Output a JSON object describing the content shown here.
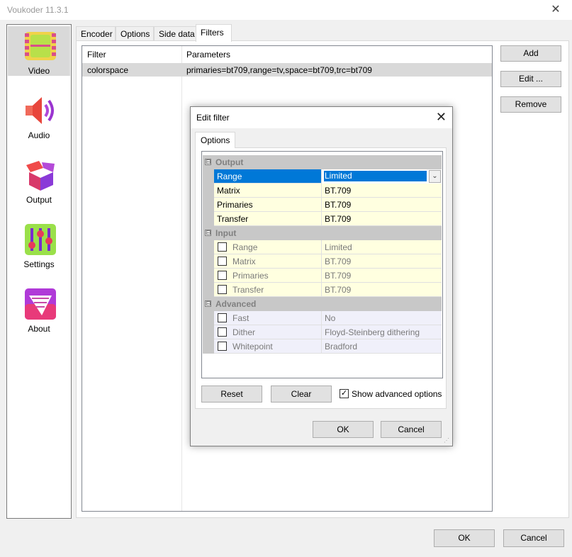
{
  "window": {
    "title": "Voukoder 11.3.1",
    "close": "✕"
  },
  "sidebar": {
    "items": [
      {
        "label": "Video",
        "icon": "film-icon"
      },
      {
        "label": "Audio",
        "icon": "speaker-icon"
      },
      {
        "label": "Output",
        "icon": "box-icon"
      },
      {
        "label": "Settings",
        "icon": "sliders-icon"
      },
      {
        "label": "About",
        "icon": "tornado-icon"
      }
    ]
  },
  "tabs": [
    "Encoder",
    "Options",
    "Side data",
    "Filters"
  ],
  "filters": {
    "columns": [
      "Filter",
      "Parameters"
    ],
    "rows": [
      {
        "filter": "colorspace",
        "parameters": "primaries=bt709,range=tv,space=bt709,trc=bt709"
      }
    ]
  },
  "buttons": {
    "add": "Add",
    "edit": "Edit ...",
    "remove": "Remove",
    "ok": "OK",
    "cancel": "Cancel"
  },
  "dialog": {
    "title": "Edit filter",
    "close": "✕",
    "tab": "Options",
    "categories": {
      "output": {
        "name": "Output",
        "expander": "⊟",
        "props": [
          {
            "name": "Range",
            "value": "Limited"
          },
          {
            "name": "Matrix",
            "value": "BT.709"
          },
          {
            "name": "Primaries",
            "value": "BT.709"
          },
          {
            "name": "Transfer",
            "value": "BT.709"
          }
        ]
      },
      "input": {
        "name": "Input",
        "expander": "⊟",
        "props": [
          {
            "name": "Range",
            "value": "Limited"
          },
          {
            "name": "Matrix",
            "value": "BT.709"
          },
          {
            "name": "Primaries",
            "value": "BT.709"
          },
          {
            "name": "Transfer",
            "value": "BT.709"
          }
        ]
      },
      "advanced": {
        "name": "Advanced",
        "expander": "⊟",
        "props": [
          {
            "name": "Fast",
            "value": "No"
          },
          {
            "name": "Dither",
            "value": "Floyd-Steinberg dithering"
          },
          {
            "name": "Whitepoint",
            "value": "Bradford"
          }
        ]
      }
    },
    "reset": "Reset",
    "clear": "Clear",
    "show_advanced": "Show advanced options",
    "show_advanced_mark": "✓",
    "dropdown_arrow": "⌄",
    "ok": "OK",
    "cancel": "Cancel"
  }
}
